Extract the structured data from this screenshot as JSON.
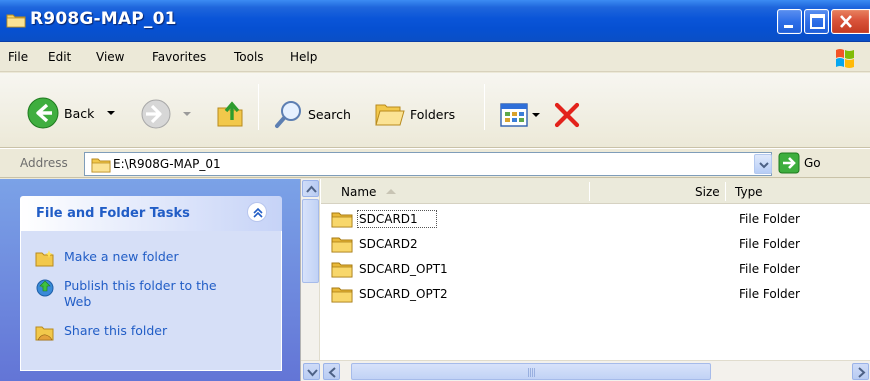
{
  "window": {
    "title": "R908G-MAP_01"
  },
  "menu": {
    "items": [
      "File",
      "Edit",
      "View",
      "Favorites",
      "Tools",
      "Help"
    ]
  },
  "toolbar": {
    "back_label": "Back",
    "search_label": "Search",
    "folders_label": "Folders"
  },
  "address": {
    "label": "Address",
    "value": "E:\\R908G-MAP_01",
    "go_label": "Go"
  },
  "tasks": {
    "title": "File and Folder Tasks",
    "items": [
      {
        "label": "Make a new folder",
        "icon": "new-folder-icon"
      },
      {
        "label": "Publish this folder to the Web",
        "icon": "publish-web-icon"
      },
      {
        "label": "Share this folder",
        "icon": "share-folder-icon"
      }
    ]
  },
  "filelist": {
    "columns": [
      "Name",
      "Size",
      "Type"
    ],
    "rows": [
      {
        "name": "SDCARD1",
        "size": "",
        "type": "File Folder"
      },
      {
        "name": "SDCARD2",
        "size": "",
        "type": "File Folder"
      },
      {
        "name": "SDCARD_OPT1",
        "size": "",
        "type": "File Folder"
      },
      {
        "name": "SDCARD_OPT2",
        "size": "",
        "type": "File Folder"
      }
    ]
  },
  "colors": {
    "title_bar": "#0a55d8",
    "task_link": "#215dc6",
    "left_pane": "#7ba2e7",
    "folder": "#f2c84b"
  }
}
